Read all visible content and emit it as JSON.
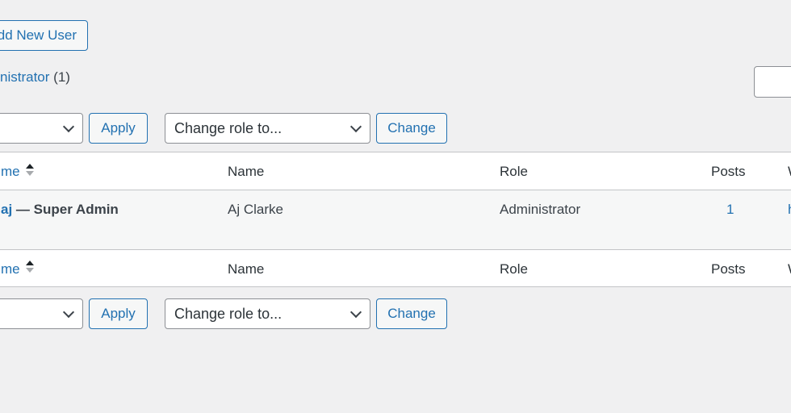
{
  "header": {
    "add_new_label": "dd New User"
  },
  "filters": {
    "role_link": "nistrator",
    "role_count": "(1)"
  },
  "top_nav": {
    "bulk_select": "",
    "apply": "Apply",
    "change_role_select": "Change role to...",
    "change": "Change"
  },
  "table": {
    "columns": [
      "me",
      "Name",
      "Role",
      "Posts",
      "W"
    ],
    "rows": [
      {
        "username": "aj",
        "suffix": "— Super Admin",
        "name": "Aj Clarke",
        "role": "Administrator",
        "posts": "1",
        "website": "h"
      }
    ]
  },
  "bottom_nav": {
    "bulk_select": "",
    "apply": "Apply",
    "change_role_select": "Change role to...",
    "change": "Change"
  }
}
